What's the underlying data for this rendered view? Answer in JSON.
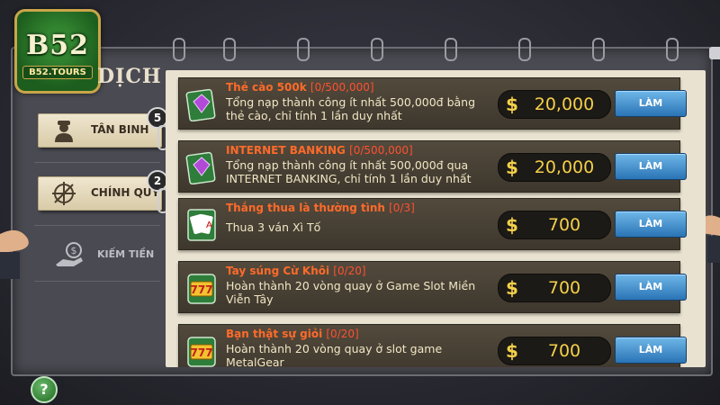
{
  "logo": {
    "main": "B52",
    "sub": "B52.TOURS"
  },
  "page_title": "DỊCH",
  "sidebar": {
    "tabs": [
      {
        "label": "TÂN BINH",
        "badge": "5",
        "icon": "soldier-icon"
      },
      {
        "label": "CHÍNH QUY",
        "badge": "2",
        "icon": "crosshair-icon"
      }
    ],
    "earn_label": "KIẾM TIỀN"
  },
  "tasks": [
    {
      "title": "Thẻ cào 500k",
      "progress": "[0/500,000]",
      "desc": "Tổng nạp thành công ít nhất 500,000đ bằng thẻ cào, chỉ tính 1 lần duy nhất",
      "currency": "$",
      "reward": "20,000",
      "button": "LÀM",
      "icon": "gem-card-icon"
    },
    {
      "title": "INTERNET BANKING",
      "progress": "[0/500,000]",
      "desc": "Tổng nạp thành công ít nhất 500,000đ qua INTERNET BANKING, chỉ tính 1 lần duy nhất",
      "currency": "$",
      "reward": "20,000",
      "button": "LÀM",
      "icon": "gem-card-icon"
    },
    {
      "title": "Thắng thua là thường tình",
      "progress": "[0/3]",
      "desc": "Thua 3 ván Xì Tố",
      "currency": "$",
      "reward": "700",
      "button": "LÀM",
      "icon": "playing-cards-icon"
    },
    {
      "title": "Tay súng Cừ Khôi",
      "progress": "[0/20]",
      "desc": "Hoàn thành 20 vòng quay ở Game Slot Miền Viễn Tây",
      "currency": "$",
      "reward": "700",
      "button": "LÀM",
      "icon": "slot-777-icon"
    },
    {
      "title": "Bạn thật sự giỏi",
      "progress": "[0/20]",
      "desc": "Hoàn thành 20 vòng quay ở slot game MetalGear",
      "currency": "$",
      "reward": "700",
      "button": "LÀM",
      "icon": "slot-777-icon"
    }
  ],
  "help_label": "?"
}
